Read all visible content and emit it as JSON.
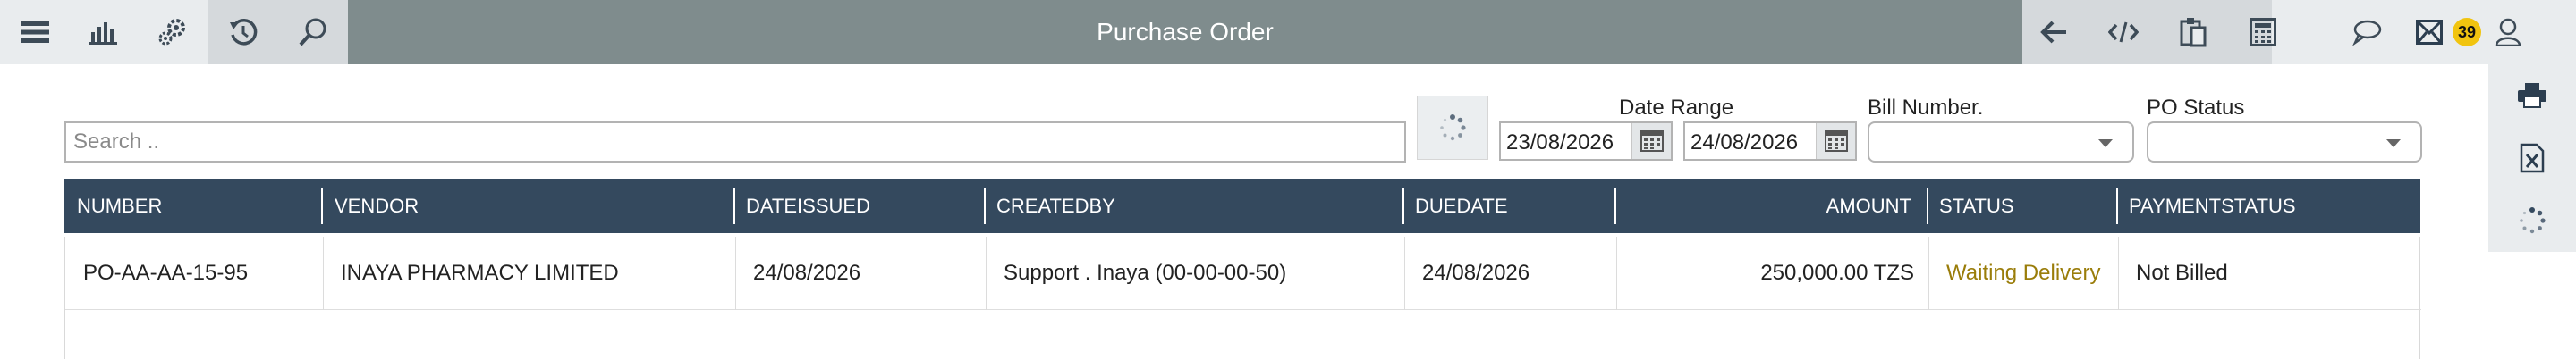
{
  "header": {
    "title": "Purchase Order",
    "notification_count": "39",
    "left_icons": [
      "menu-icon",
      "bar-chart-icon",
      "settings-gears-icon",
      "history-icon",
      "search-icon"
    ],
    "right_icons": [
      "back-arrow-icon",
      "code-icon",
      "clipboard-icon",
      "calculator-icon",
      "chat-bubble-icon",
      "mail-icon",
      "user-icon"
    ]
  },
  "side_rail": {
    "icons": [
      "printer-icon",
      "excel-export-icon",
      "loading-spinner-icon"
    ]
  },
  "filters": {
    "search_placeholder": "Search ..",
    "date_range_label": "Date Range",
    "date_from": "23/08/2026",
    "date_to": "24/08/2026",
    "bill_number_label": "Bill Number.",
    "bill_number_value": "",
    "po_status_label": "PO Status",
    "po_status_value": ""
  },
  "table": {
    "columns": [
      "NUMBER",
      "VENDOR",
      "DATEISSUED",
      "CREATEDBY",
      "DUEDATE",
      "AMOUNT",
      "STATUS",
      "PAYMENTSTATUS"
    ],
    "rows": [
      {
        "number": "PO-AA-AA-15-95",
        "vendor": "INAYA PHARMACY LIMITED",
        "dateissued": "24/08/2026",
        "createdby": "Support . Inaya (00-00-00-50)",
        "duedate": "24/08/2026",
        "amount": "250,000.00 TZS",
        "status": "Waiting Delivery",
        "paymentstatus": "Not Billed"
      }
    ]
  },
  "colors": {
    "title_bar": "#7f8c8d",
    "table_header": "#34495e",
    "status_waiting": "#9a7d0a",
    "badge": "#f1c40f"
  }
}
